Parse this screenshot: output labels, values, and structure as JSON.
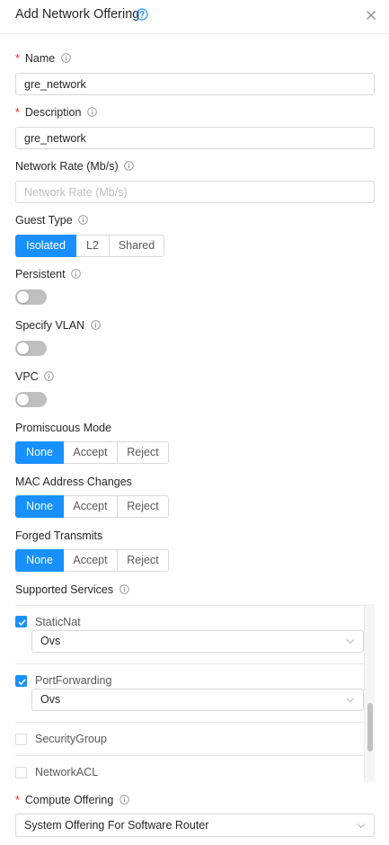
{
  "dialog": {
    "title": "Add Network Offering",
    "help_icon": "question-circle-icon",
    "close_icon": "close-icon"
  },
  "name": {
    "label": "Name",
    "required": "*",
    "value": "gre_network"
  },
  "description": {
    "label": "Description",
    "required": "*",
    "value": "gre_network"
  },
  "network_rate": {
    "label": "Network Rate (Mb/s)",
    "placeholder": "Network Rate (Mb/s)",
    "value": ""
  },
  "guest_type": {
    "label": "Guest Type",
    "options": [
      "Isolated",
      "L2",
      "Shared"
    ],
    "selected": "Isolated"
  },
  "persistent": {
    "label": "Persistent",
    "enabled": false
  },
  "specify_vlan": {
    "label": "Specify VLAN",
    "enabled": false
  },
  "vpc": {
    "label": "VPC",
    "enabled": false
  },
  "promiscuous_mode": {
    "label": "Promiscuous Mode",
    "options": [
      "None",
      "Accept",
      "Reject"
    ],
    "selected": "None"
  },
  "mac_address_changes": {
    "label": "MAC Address Changes",
    "options": [
      "None",
      "Accept",
      "Reject"
    ],
    "selected": "None"
  },
  "forged_transmits": {
    "label": "Forged Transmits",
    "options": [
      "None",
      "Accept",
      "Reject"
    ],
    "selected": "None"
  },
  "supported_services": {
    "label": "Supported Services",
    "items": [
      {
        "name": "StaticNat",
        "checked": true,
        "provider": "Ovs"
      },
      {
        "name": "PortForwarding",
        "checked": true,
        "provider": "Ovs"
      },
      {
        "name": "SecurityGroup",
        "checked": false
      },
      {
        "name": "NetworkACL",
        "checked": false
      }
    ]
  },
  "compute_offering": {
    "label": "Compute Offering",
    "required": "*",
    "value": "System Offering For Software Router"
  },
  "colors": {
    "primary": "#1890ff",
    "required": "#f5222d",
    "border": "#d9d9d9"
  }
}
